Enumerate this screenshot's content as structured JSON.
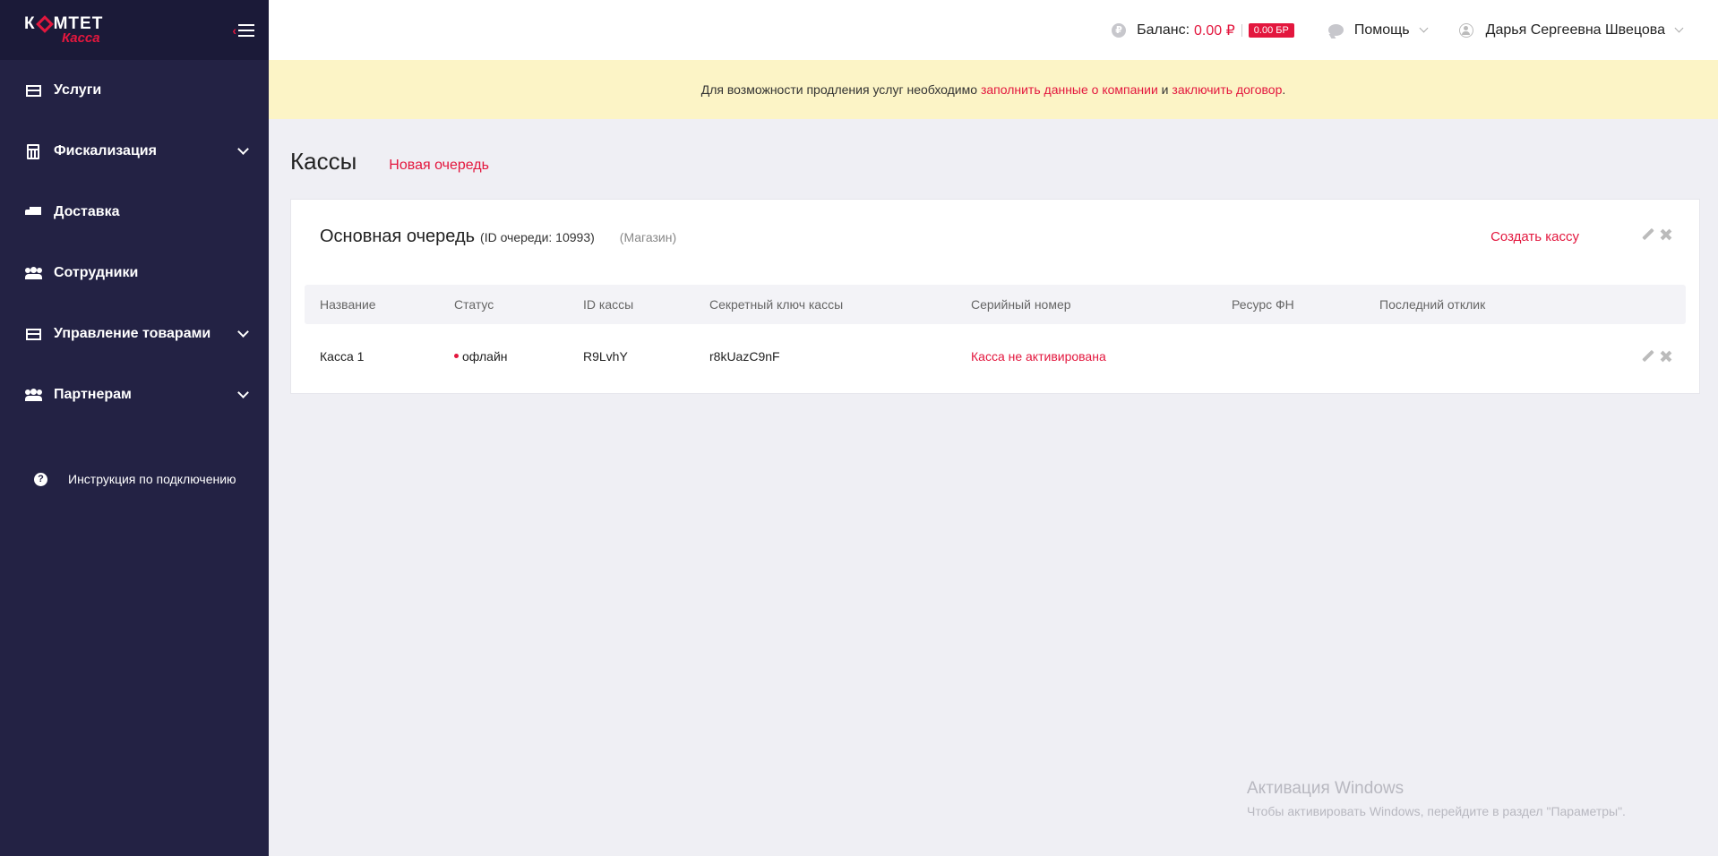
{
  "app": {
    "logo_top_left": "К",
    "logo_top_right": "МТЕТ",
    "logo_bottom": "Касса"
  },
  "sidebar": {
    "items": [
      {
        "label": "Услуги",
        "icon": "card-icon",
        "has_dropdown": false
      },
      {
        "label": "Фискализация",
        "icon": "calculator-icon",
        "has_dropdown": true
      },
      {
        "label": "Доставка",
        "icon": "truck-icon",
        "has_dropdown": false
      },
      {
        "label": "Сотрудники",
        "icon": "users-icon",
        "has_dropdown": false
      },
      {
        "label": "Управление товарами",
        "icon": "card-icon",
        "has_dropdown": true
      },
      {
        "label": "Партнерам",
        "icon": "users-icon",
        "has_dropdown": true
      }
    ],
    "help_label": "Инструкция по подключению"
  },
  "topbar": {
    "balance_label": "Баланс:",
    "balance_value": "0.00 ₽",
    "br_badge": "0.00 БР",
    "help_label": "Помощь",
    "user_name": "Дарья Сергеевна Швецова"
  },
  "notice": {
    "text_before": "Для возможности продления услуг необходимо ",
    "link1": "заполнить данные о компании",
    "text_middle": " и ",
    "link2": "заключить договор",
    "text_after": "."
  },
  "page": {
    "title": "Кассы",
    "new_queue_link": "Новая очередь"
  },
  "queue": {
    "name": "Основная очередь",
    "id_text": "(ID очереди: 10993)",
    "type_text": "(Магазин)",
    "create_link": "Создать кассу",
    "columns": [
      "Название",
      "Статус",
      "ID кассы",
      "Секретный ключ кассы",
      "Серийный номер",
      "Ресурс ФН",
      "Последний отклик"
    ],
    "rows": [
      {
        "name": "Касса 1",
        "status": "офлайн",
        "kassa_id": "R9LvhY",
        "secret_key": "r8kUazC9nF",
        "serial": "Касса не активирована",
        "fn_resource": "",
        "last_response": ""
      }
    ]
  },
  "watermark": {
    "title": "Активация Windows",
    "subtitle": "Чтобы активировать Windows, перейдите в раздел \"Параметры\"."
  },
  "colors": {
    "accent": "#e3173e",
    "sidebar_bg": "#232244",
    "notice_bg": "#fcf4c6",
    "page_bg": "#efeff4"
  }
}
